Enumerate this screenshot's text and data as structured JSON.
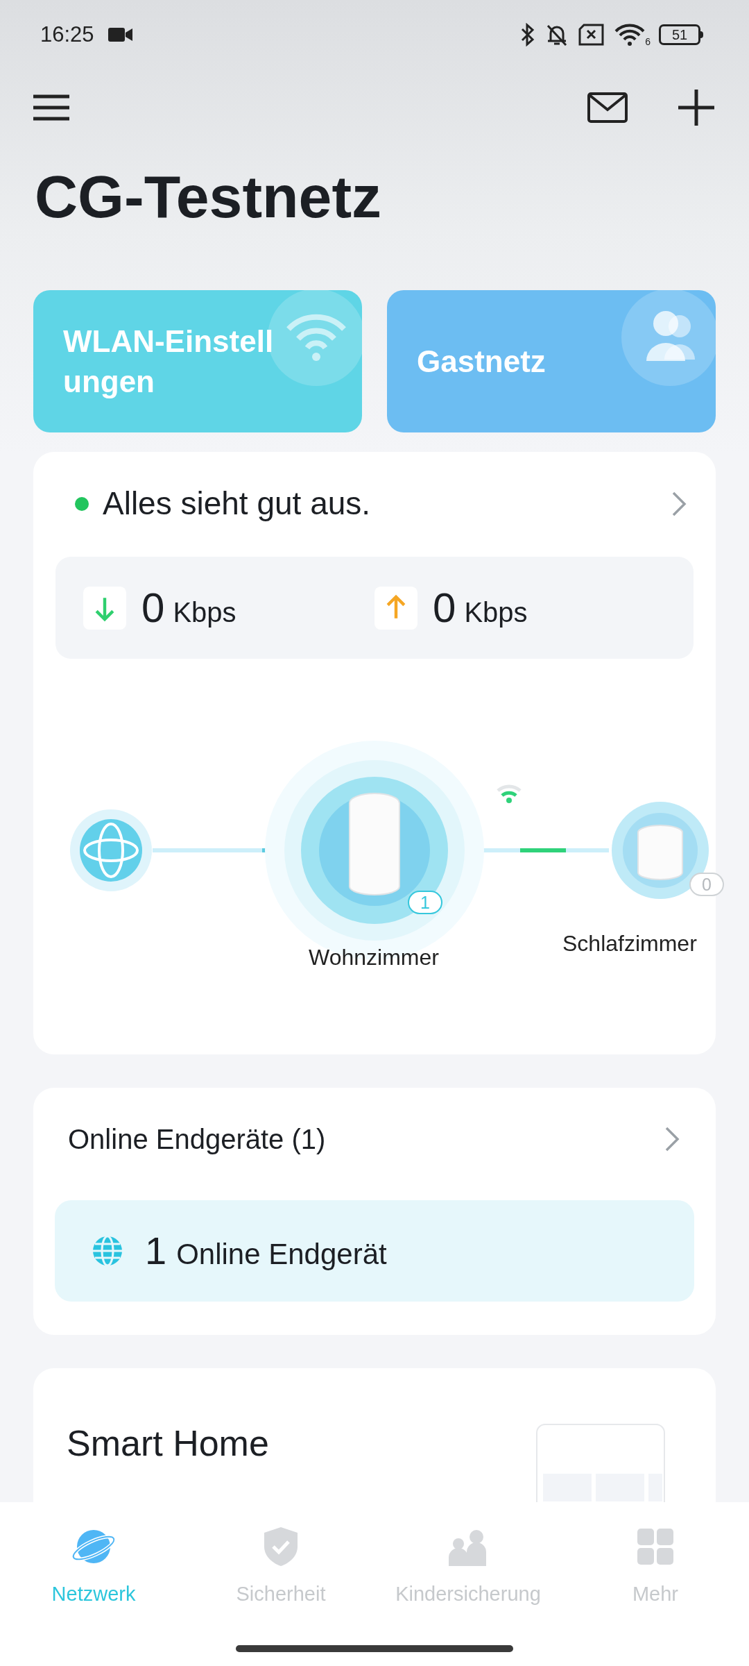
{
  "status_bar": {
    "time": "16:25",
    "wifi_badge": "6",
    "battery": "51"
  },
  "network_name": "CG-Testnetz",
  "quick_actions": [
    {
      "kind": "wifi",
      "lines": [
        "WLAN-Einstell",
        "ungen"
      ],
      "color": "#5fd5e6"
    },
    {
      "kind": "guest",
      "lines": [
        "Gastnetz"
      ],
      "color": "#6cbdf2"
    }
  ],
  "status": {
    "text": "Alles sieht gut aus.",
    "color": "#22c55e"
  },
  "speeds": [
    {
      "kind": "download",
      "value": "0",
      "unit": "Kbps"
    },
    {
      "kind": "upload",
      "value": "0",
      "unit": "Kbps"
    }
  ],
  "topology": {
    "nodes": [
      {
        "kind": "internet"
      },
      {
        "kind": "router",
        "label": "Wohnzimmer",
        "clients": "1"
      },
      {
        "kind": "satellite",
        "label": "Schlafzimmer",
        "clients": "0"
      }
    ]
  },
  "online_devices": {
    "title": "Online Endgeräte (1)",
    "count": "1",
    "label": "Online Endgerät"
  },
  "smart_home": {
    "title": "Smart Home"
  },
  "nav": [
    {
      "kind": "network",
      "label": "Netzwerk",
      "selected": true
    },
    {
      "kind": "security",
      "label": "Sicherheit",
      "selected": false
    },
    {
      "kind": "parental",
      "label": "Kindersicherung",
      "selected": false
    },
    {
      "kind": "more",
      "label": "Mehr",
      "selected": false
    }
  ]
}
